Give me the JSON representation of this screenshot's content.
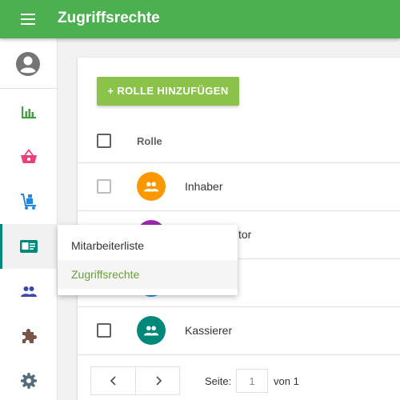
{
  "app": {
    "title": "Zugriffsrechte"
  },
  "colors": {
    "primary": "#4caf50",
    "accent": "#8bc34a",
    "active_indicator": "#00897b"
  },
  "sidebar": {
    "user_icon": "account-circle-icon",
    "items": [
      {
        "name": "statistics",
        "icon": "bar-chart-icon",
        "color": "#43a047"
      },
      {
        "name": "sales",
        "icon": "shopping-basket-icon",
        "color": "#ec407a"
      },
      {
        "name": "inventory",
        "icon": "hand-truck-icon",
        "color": "#1e88e5"
      },
      {
        "name": "staff",
        "icon": "id-card-icon",
        "color": "#00897b",
        "active": true
      },
      {
        "name": "customers",
        "icon": "group-icon",
        "color": "#3949ab"
      },
      {
        "name": "extensions",
        "icon": "puzzle-piece-icon",
        "color": "#795548"
      },
      {
        "name": "settings",
        "icon": "gear-icon",
        "color": "#546e7a"
      }
    ]
  },
  "staff_menu": {
    "items": [
      {
        "label": "Mitarbeiterliste"
      },
      {
        "label": "Zugriffsrechte",
        "selected": true
      }
    ]
  },
  "main": {
    "add_button_label": "+ ROLLE HINZUFÜGEN",
    "table": {
      "column_header": "Rolle",
      "rows": [
        {
          "label": "Inhaber",
          "avatar_color": "#fb9800",
          "avatar_icon": "group-icon"
        },
        {
          "label": "tor",
          "avatar_color": "#9c27b0",
          "avatar_icon": "group-icon"
        },
        {
          "label": "",
          "avatar_color": "#1e88e5",
          "avatar_icon": "group-icon"
        },
        {
          "label": "Kassierer",
          "avatar_color": "#00897b",
          "avatar_icon": "group-icon"
        }
      ]
    },
    "pagination": {
      "page_label": "Seite:",
      "current_page": "1",
      "total_label": "von 1"
    }
  }
}
